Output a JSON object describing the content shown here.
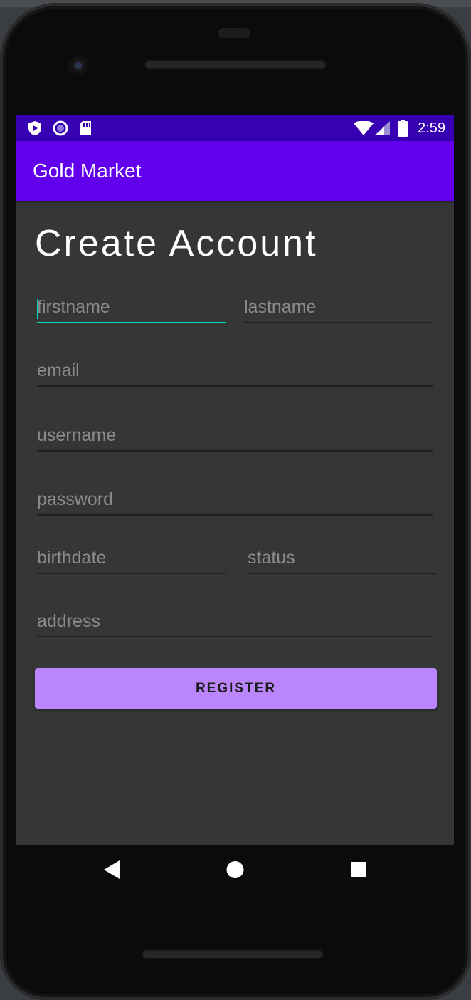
{
  "status_bar": {
    "time": "2:59",
    "left_icons": [
      "shield-icon",
      "circle-icon",
      "sd-card-icon"
    ],
    "right_icons": [
      "wifi-icon",
      "signal-icon",
      "battery-icon"
    ]
  },
  "app_bar": {
    "title": "Gold Market"
  },
  "form": {
    "heading": "Create Account",
    "firstname_placeholder": "firstname",
    "lastname_placeholder": "lastname",
    "email_placeholder": "email",
    "username_placeholder": "username",
    "password_placeholder": "password",
    "birthdate_placeholder": "birthdate",
    "status_placeholder": "status",
    "address_placeholder": "address",
    "register_label": "REGISTER"
  },
  "nav_bar": {
    "buttons": [
      "back-icon",
      "home-icon",
      "recents-icon"
    ]
  },
  "colors": {
    "status_bar": "#3700b3",
    "app_bar": "#6200ee",
    "background": "#353737",
    "accent": "#03dac5",
    "button": "#bb86fc"
  }
}
